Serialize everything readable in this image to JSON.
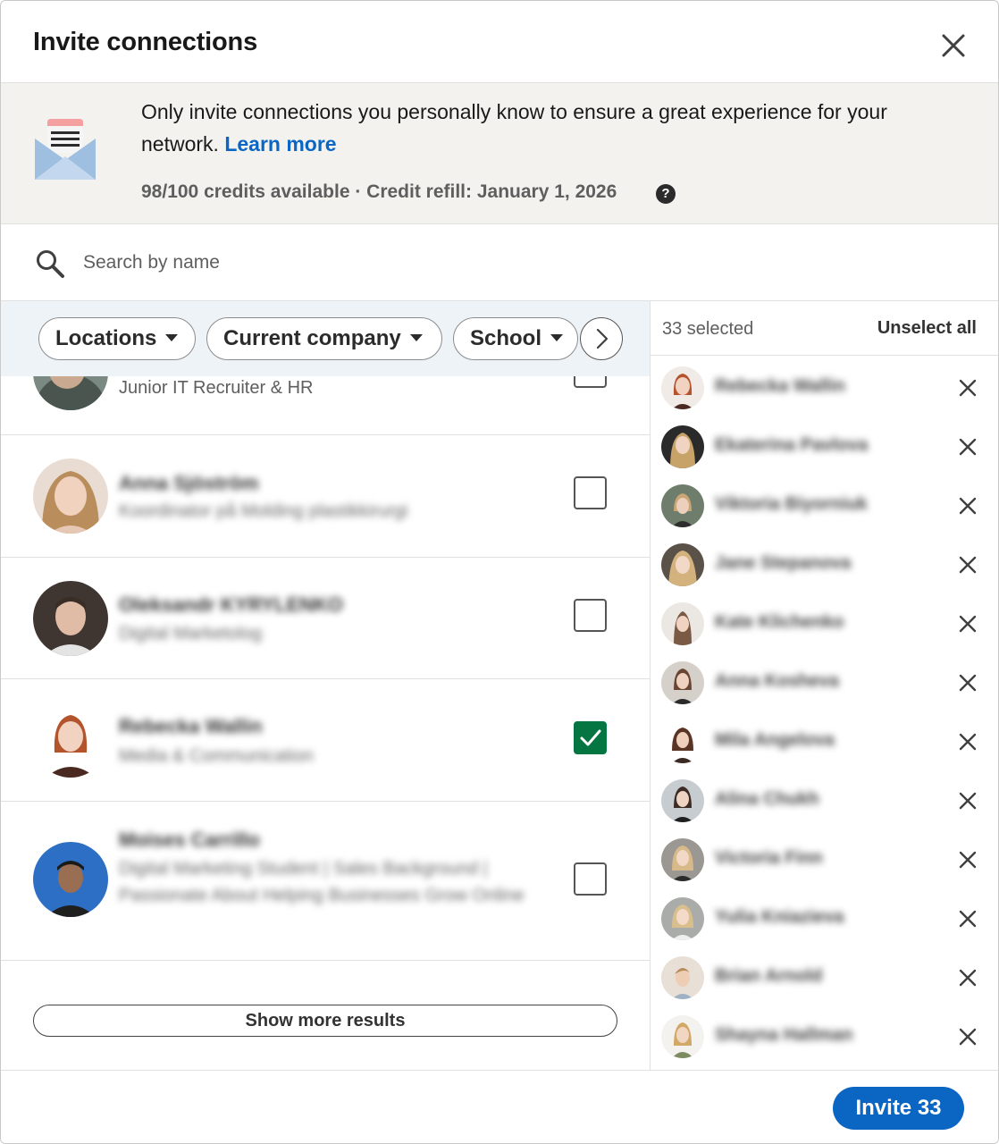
{
  "header": {
    "title": "Invite connections"
  },
  "banner": {
    "message": "Only invite connections you personally know to ensure a great experience for your network.",
    "learn_more": "Learn more",
    "credits": "98/100 credits available · Credit refill: January 1, 2026",
    "help_glyph": "?"
  },
  "search": {
    "placeholder": "Search by name"
  },
  "filters": [
    {
      "label": "Locations"
    },
    {
      "label": "Current company"
    },
    {
      "label": "School"
    }
  ],
  "people": [
    {
      "name": "",
      "subtitle": "Junior IT Recruiter & HR",
      "checked": false
    },
    {
      "name": "Anna Sjöström",
      "subtitle": "Koordinator på Molding plastikkirurgi",
      "checked": false
    },
    {
      "name": "Oleksandr KYRYLENKO",
      "subtitle": "Digital Marketolog",
      "checked": false
    },
    {
      "name": "Rebecka Wallin",
      "subtitle": "Media & Communication",
      "checked": true
    },
    {
      "name": "Moises Carrillo",
      "subtitle": "Digital Marketing Student | Sales Background | Passionate About Helping Businesses Grow Online",
      "checked": false
    }
  ],
  "show_more": "Show more results",
  "selected": {
    "count_label": "33 selected",
    "unselect_all": "Unselect all",
    "items": [
      {
        "name": "Rebecka Wallin"
      },
      {
        "name": "Ekaterina Pavlova"
      },
      {
        "name": "Viktoria Biyorniuk"
      },
      {
        "name": "Jane Stepanova"
      },
      {
        "name": "Kate Klichenko"
      },
      {
        "name": "Anna Kosheva"
      },
      {
        "name": "Mila Angelova"
      },
      {
        "name": "Alina Chukh"
      },
      {
        "name": "Victoria Finn"
      },
      {
        "name": "Yulia Kniazieva"
      },
      {
        "name": "Brian Arnold"
      },
      {
        "name": "Shayna Hallman"
      }
    ]
  },
  "footer": {
    "invite_label": "Invite 33"
  },
  "colors": {
    "brand": "#0a66c2",
    "checked": "#057642",
    "banner_bg": "#f3f2ef",
    "filter_bg": "#eef3f8"
  }
}
